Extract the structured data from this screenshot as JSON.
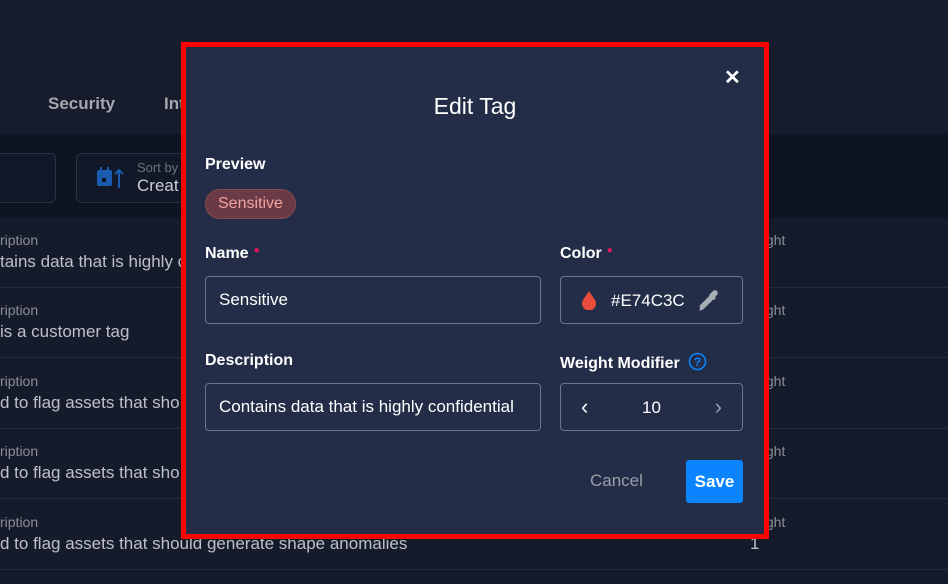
{
  "background": {
    "nav": [
      "Security",
      "Int"
    ],
    "sort": {
      "label": "Sort by",
      "value": "Creat"
    },
    "rows": [
      {
        "label": "ription",
        "value": "tains data that is highly c",
        "weight_label": "eight"
      },
      {
        "label": "ription",
        "value": "is a customer tag",
        "weight_label": "eight"
      },
      {
        "label": "ription",
        "value": "d to flag assets that sho",
        "weight_label": "eight"
      },
      {
        "label": "ription",
        "value": "d to flag assets that sho",
        "weight_label": "eight"
      },
      {
        "label": "ription",
        "value": "d to flag assets that should generate shape anomalies",
        "weight_label": "eight",
        "weight": "1"
      }
    ]
  },
  "modal": {
    "title": "Edit Tag",
    "close_icon": "close-icon",
    "preview_label": "Preview",
    "preview_chip": "Sensitive",
    "name_label": "Name",
    "name_value": "Sensitive",
    "color_label": "Color",
    "color_value": "#E74C3C",
    "description_label": "Description",
    "description_value": "Contains data that is highly confidential",
    "weight_label": "Weight Modifier",
    "weight_value": "10",
    "cancel": "Cancel",
    "save": "Save"
  },
  "colors": {
    "accent": "#0a84ff",
    "tag": "#E74C3C",
    "required": "#e8175d",
    "highlight_border": "#ff0000"
  }
}
